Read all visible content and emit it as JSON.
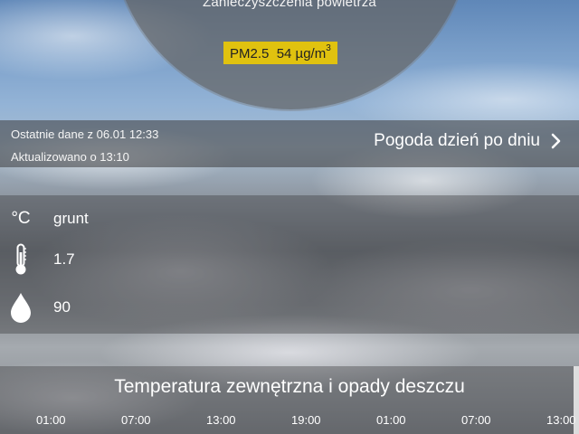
{
  "air_quality": {
    "title": "Zanieczyszczenia powietrza",
    "pm_label": "PM2.5",
    "pm_value": "54 µg/m",
    "pm_unit_sup": "3",
    "badge_color": "#e0c20f"
  },
  "status": {
    "last_data": "Ostatnie dane z 06.01 12:33",
    "updated": "Aktualizowano o 13:10",
    "forecast_link": "Pogoda dzień po dniu",
    "forecast_icon": "chevron-right-icon"
  },
  "ground": {
    "unit": "°C",
    "label": "grunt",
    "temperature": "1.7",
    "temperature_icon": "thermometer-icon",
    "humidity": "90",
    "humidity_icon": "water-drop-icon"
  },
  "chart": {
    "title": "Temperatura zewnętrzna i opady deszczu",
    "times": [
      "01:00",
      "07:00",
      "13:00",
      "19:00",
      "01:00",
      "07:00",
      "13:00"
    ]
  }
}
